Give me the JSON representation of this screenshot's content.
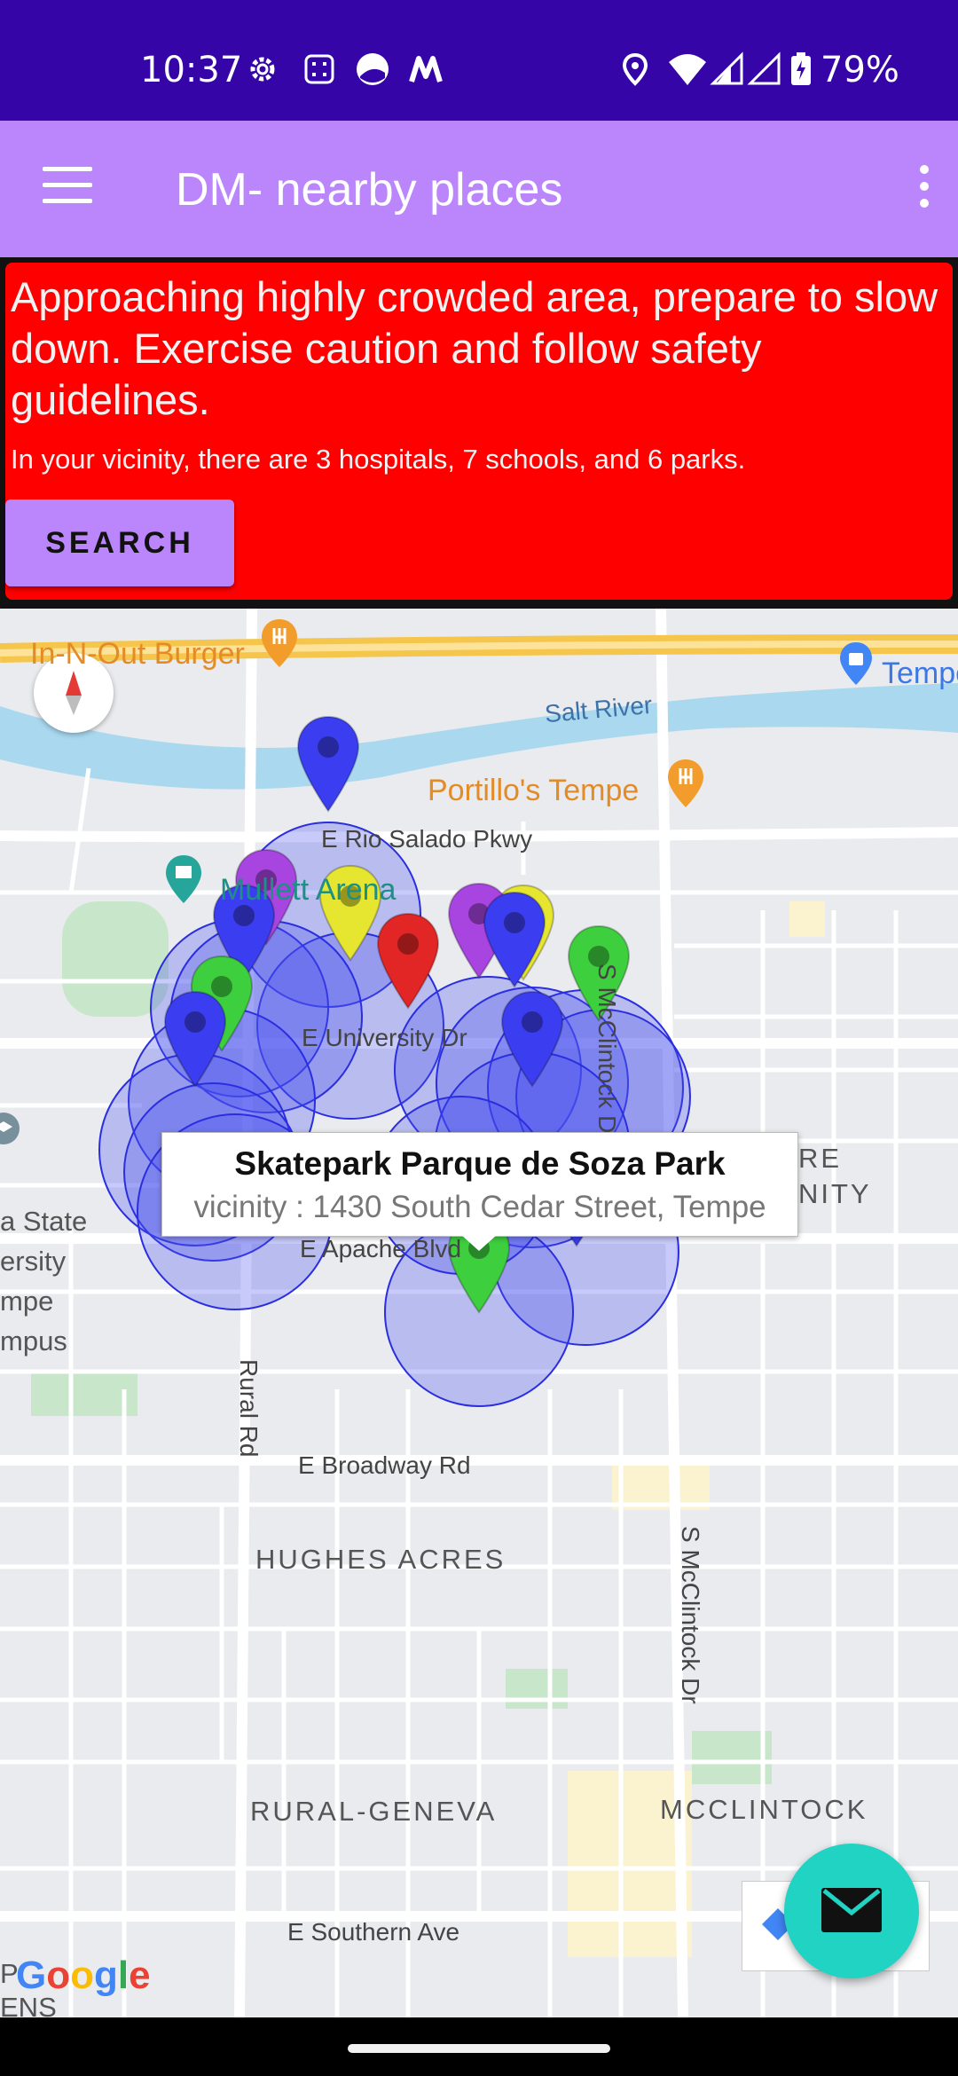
{
  "status_bar": {
    "time": "10:37",
    "battery": "79%",
    "icons": [
      "settings-gear-icon",
      "calculator-icon",
      "moon-app-icon",
      "m-app-icon",
      "location-icon",
      "wifi-icon",
      "signal-icon",
      "signal-icon-2",
      "battery-charging-icon"
    ]
  },
  "app_bar": {
    "title": "DM- nearby places",
    "menu_icon": "hamburger-menu-icon",
    "overflow_icon": "more-vert-icon",
    "background": "#bb86fc"
  },
  "alert": {
    "message": "Approaching highly crowded area, prepare to slow down. Exercise caution and follow safety guidelines.",
    "summary": "In your vicinity, there are 3 hospitals, 7 schools, and 6 parks.",
    "search_label": "SEARCH",
    "background": "#ff0000"
  },
  "map": {
    "places": {
      "in_n_out": "In-N-Out Burger",
      "tempe": "Tempe",
      "salt_river": "Salt River",
      "portillos": "Portillo's Tempe",
      "rio_salado": "E Rio Salado Pkwy",
      "mullett_arena": "Mullett Arena",
      "university_dr": "E University Dr",
      "mcclintock_dr": "S McClintock Dr",
      "apache_blvd": "E Apache Blvd",
      "rural_rd": "Rural Rd",
      "broadway": "E Broadway Rd",
      "hughes_acres": "HUGHES ACRES",
      "rural_geneva": "RURAL-GENEVA",
      "mcclintock": "MCCLINTOCK",
      "southern_ave": "E Southern Ave",
      "state_campus": "a State\nersity\nmpe\nmpus",
      "unity": "RE\nNITY",
      "ens": "P\nENS"
    },
    "info_window": {
      "title": "Skatepark Parque de Soza Park",
      "subtitle": "vicinity : 1430 South Cedar Street, Tempe"
    },
    "marker_colors": {
      "blue": "#3b3ef0",
      "purple": "#a844e0",
      "yellow": "#e6e630",
      "red": "#e22525",
      "green": "#3ecf3e"
    },
    "attribution": "Google"
  },
  "fab": {
    "icon": "mail-icon"
  }
}
